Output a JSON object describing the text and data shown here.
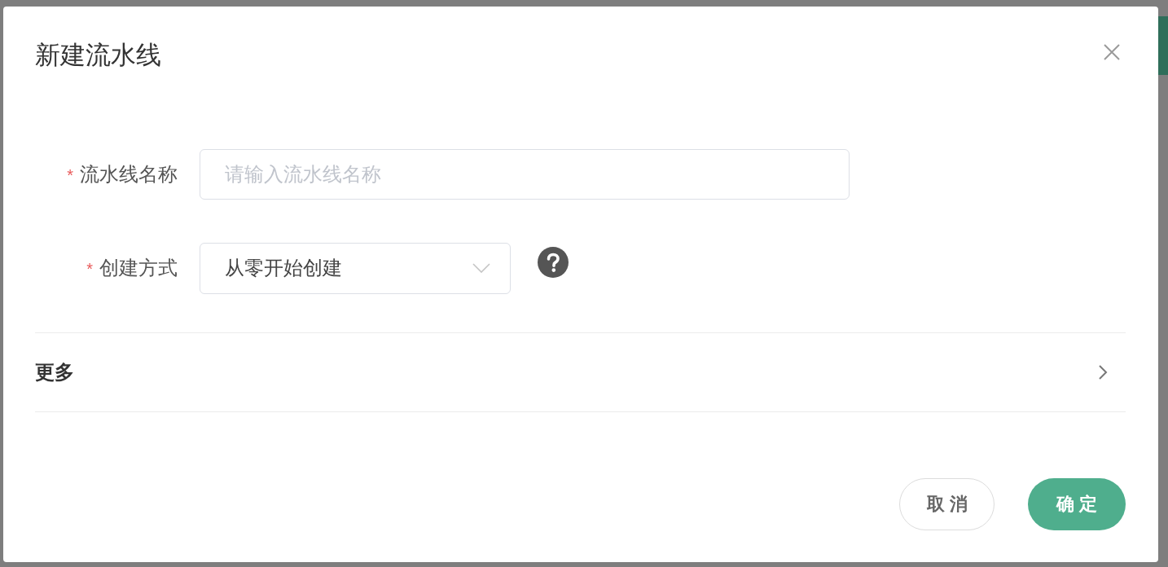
{
  "dialog": {
    "title": "新建流水线"
  },
  "form": {
    "fields": [
      {
        "kind": "input",
        "required_mark": "*",
        "label": "流水线名称",
        "placeholder": "请输入流水线名称"
      },
      {
        "kind": "select",
        "required_mark": "*",
        "label": "创建方式",
        "value": "从零开始创建",
        "help": true
      }
    ]
  },
  "more_section": {
    "label": "更多",
    "expanded": false
  },
  "buttons": [
    {
      "kind": "secondary",
      "label": "取消"
    },
    {
      "kind": "primary",
      "label": "确定"
    }
  ]
}
